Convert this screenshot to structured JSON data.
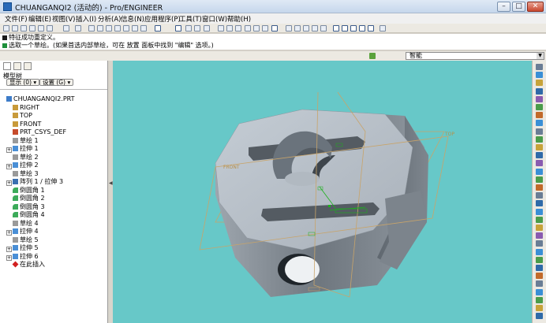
{
  "window": {
    "title": "CHUANGANQI2 (活动的) - Pro/ENGINEER"
  },
  "menu": [
    "文件(F)",
    "编辑(E)",
    "视图(V)",
    "插入(I)",
    "分析(A)",
    "信息(N)",
    "应用程序(P)",
    "工具(T)",
    "窗口(W)",
    "帮助(H)"
  ],
  "messages": {
    "line1": "特征成功重定义。",
    "line2": "选取一个草绘。(如果首选内部草绘，可在 放置 面板中找到 \"编辑\" 选项。)"
  },
  "filter": {
    "selected": "智能"
  },
  "model_tree": {
    "label": "模型树",
    "show_button": "显示 (0)",
    "settings_button": "设置 (G)",
    "items": [
      {
        "label": "CHUANGANQI2.PRT",
        "icon": "part-icon",
        "level": 0,
        "expander": false
      },
      {
        "label": "RIGHT",
        "icon": "datum-plane-icon",
        "level": 1,
        "expander": false
      },
      {
        "label": "TOP",
        "icon": "datum-plane-icon",
        "level": 1,
        "expander": false
      },
      {
        "label": "FRONT",
        "icon": "datum-plane-icon",
        "level": 1,
        "expander": false
      },
      {
        "label": "PRT_CSYS_DEF",
        "icon": "csys-icon",
        "level": 1,
        "expander": false
      },
      {
        "label": "草绘 1",
        "icon": "sketch-icon",
        "level": 1,
        "expander": false
      },
      {
        "label": "拉伸 1",
        "icon": "extrude-icon",
        "level": 1,
        "expander": true
      },
      {
        "label": "草绘 2",
        "icon": "sketch-icon",
        "level": 1,
        "expander": false
      },
      {
        "label": "拉伸 2",
        "icon": "extrude-icon",
        "level": 1,
        "expander": true
      },
      {
        "label": "草绘 3",
        "icon": "sketch-icon",
        "level": 1,
        "expander": false
      },
      {
        "label": "阵列 1 / 拉伸 3",
        "icon": "pattern-icon",
        "level": 1,
        "expander": true
      },
      {
        "label": "倒圆角 1",
        "icon": "round-icon",
        "level": 1,
        "expander": false
      },
      {
        "label": "倒圆角 2",
        "icon": "round-icon",
        "level": 1,
        "expander": false
      },
      {
        "label": "倒圆角 3",
        "icon": "round-icon",
        "level": 1,
        "expander": false
      },
      {
        "label": "倒圆角 4",
        "icon": "round-icon",
        "level": 1,
        "expander": false
      },
      {
        "label": "草绘 4",
        "icon": "sketch-icon",
        "level": 1,
        "expander": false
      },
      {
        "label": "拉伸 4",
        "icon": "extrude-icon",
        "level": 1,
        "expander": true
      },
      {
        "label": "草绘 5",
        "icon": "sketch-icon",
        "level": 1,
        "expander": false
      },
      {
        "label": "拉伸 5",
        "icon": "extrude-icon",
        "level": 1,
        "expander": true
      },
      {
        "label": "拉伸 6",
        "icon": "extrude-icon",
        "level": 1,
        "expander": true
      },
      {
        "label": "在此插入",
        "icon": "insert-here-icon",
        "level": 1,
        "expander": false
      }
    ]
  },
  "viewport": {
    "background_color": "#67c8c8",
    "datum_labels": {
      "top": "TOP",
      "front": "FRONT"
    }
  },
  "colors": {
    "part_top": "#b6bec7",
    "part_side": "#7d858e",
    "datum": "#c8a46a"
  }
}
